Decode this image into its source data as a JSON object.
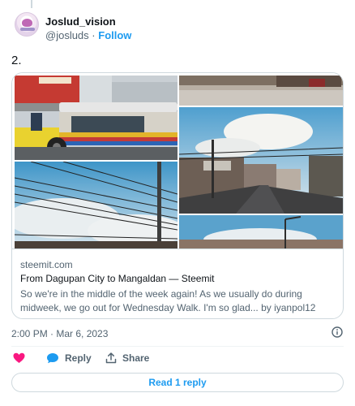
{
  "author": {
    "display_name": "Joslud_vision",
    "handle": "@josluds",
    "separator": "·",
    "follow_label": "Follow"
  },
  "tweet": {
    "text": "2."
  },
  "link_card": {
    "domain": "steemit.com",
    "title": "From Dagupan City to Mangaldan — Steemit",
    "description": "So we're in the middle of the week again! As we usually do during midweek, we go out for Wednesday Walk. I'm so glad... by iyanpol12"
  },
  "meta": {
    "timestamp": "2:00 PM · Mar 6, 2023"
  },
  "actions": {
    "reply_label": "Reply",
    "share_label": "Share"
  },
  "thread": {
    "read_replies_label": "Read 1 reply"
  },
  "colors": {
    "accent": "#1d9bf0",
    "like_heart": "#f91880",
    "secondary_text": "#536471",
    "border": "#cfd9de"
  },
  "icons": [
    "heart-icon",
    "reply-bubble-icon",
    "share-icon",
    "info-icon"
  ]
}
